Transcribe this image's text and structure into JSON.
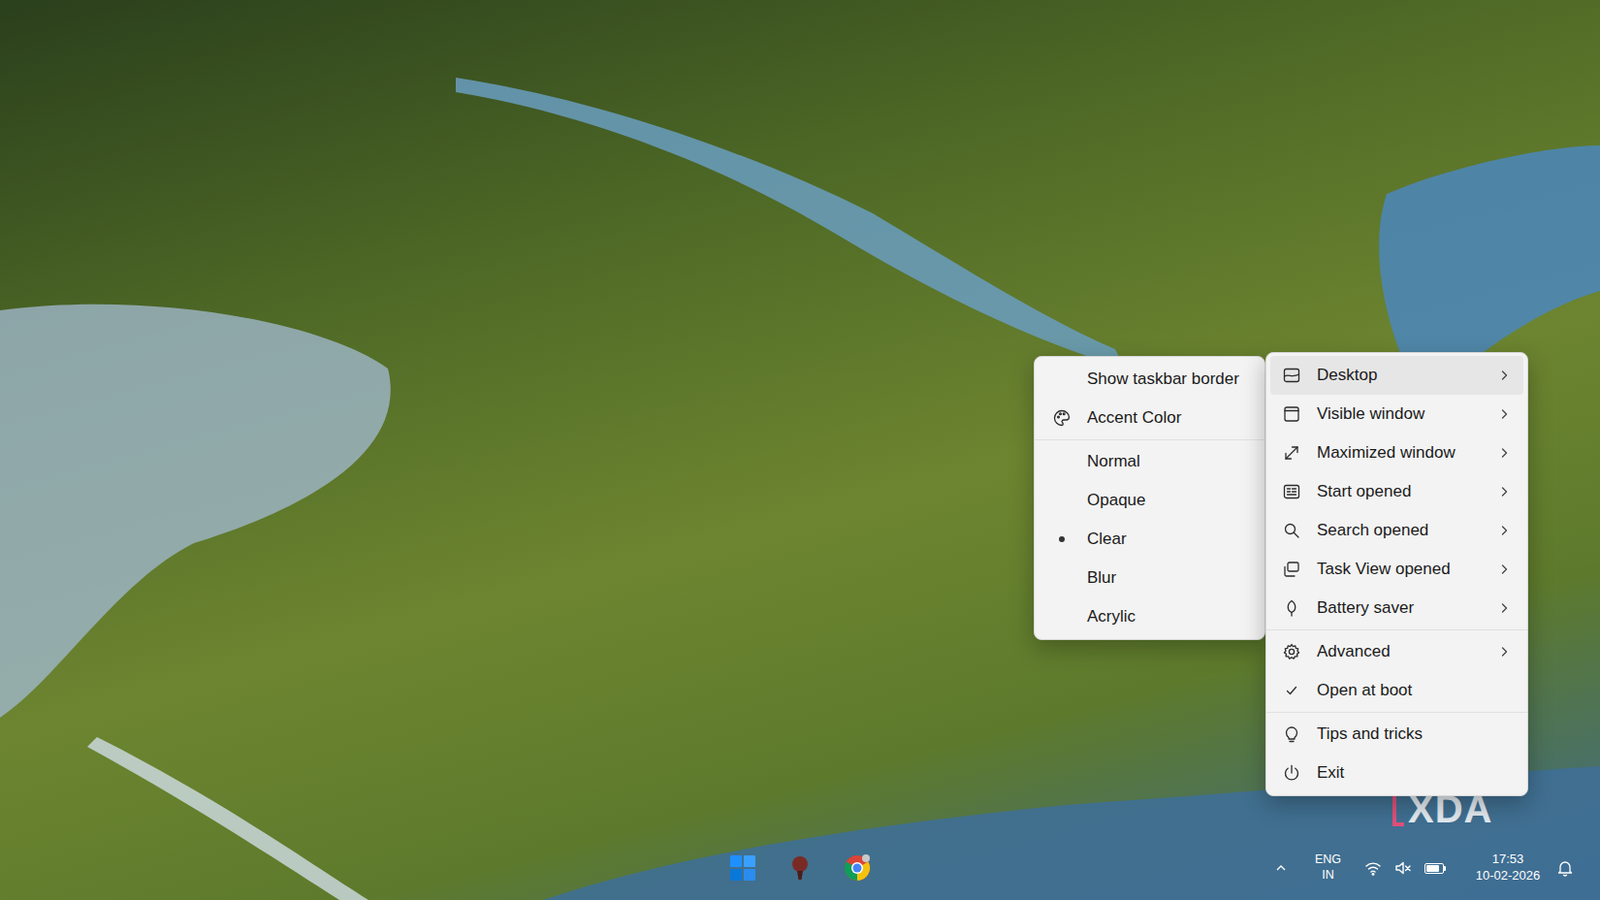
{
  "desktop": {
    "watermark": "XDA"
  },
  "context_menu": {
    "groups": [
      [
        {
          "label": "Desktop",
          "kind": "submenu",
          "expanded": true
        },
        {
          "label": "Visible window",
          "kind": "submenu",
          "expanded": false
        },
        {
          "label": "Maximized window",
          "kind": "submenu",
          "expanded": false
        },
        {
          "label": "Start opened",
          "kind": "submenu",
          "expanded": false
        },
        {
          "label": "Search opened",
          "kind": "submenu",
          "expanded": false
        },
        {
          "label": "Task View opened",
          "kind": "submenu",
          "expanded": false
        },
        {
          "label": "Battery saver",
          "kind": "submenu",
          "expanded": false
        }
      ],
      [
        {
          "label": "Advanced",
          "kind": "submenu",
          "expanded": false
        },
        {
          "label": "Open at boot",
          "kind": "toggle",
          "checked": true
        }
      ],
      [
        {
          "label": "Tips and tricks",
          "kind": "action"
        },
        {
          "label": "Exit",
          "kind": "action"
        }
      ]
    ]
  },
  "submenu": {
    "options": [
      {
        "label": "Show taskbar border",
        "kind": "toggle",
        "checked": false
      },
      {
        "label": "Accent Color",
        "kind": "action"
      }
    ],
    "modes": [
      {
        "label": "Normal",
        "selected": false
      },
      {
        "label": "Opaque",
        "selected": false
      },
      {
        "label": "Clear",
        "selected": true
      },
      {
        "label": "Blur",
        "selected": false
      },
      {
        "label": "Acrylic",
        "selected": false
      }
    ]
  },
  "taskbar": {
    "tray": {
      "language": "ENG",
      "region": "IN",
      "muted": true,
      "battery_level": 0.8,
      "time": "17:53",
      "date": "10-02-2026"
    }
  }
}
